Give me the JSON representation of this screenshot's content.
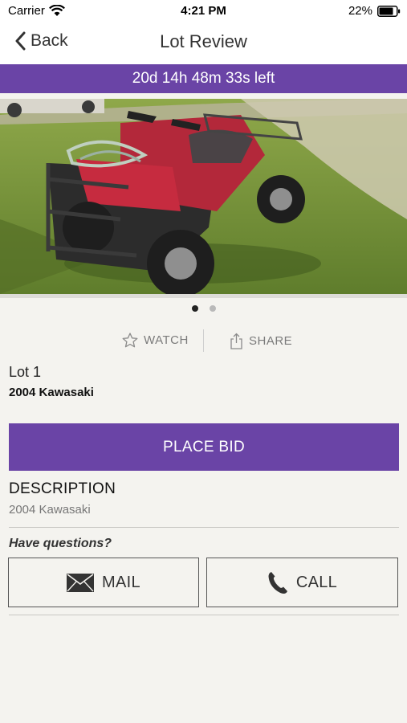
{
  "status": {
    "carrier": "Carrier",
    "time": "4:21 PM",
    "battery": "22%"
  },
  "nav": {
    "back_label": "Back",
    "title": "Lot Review"
  },
  "timer": {
    "text": "20d 14h 48m 33s left"
  },
  "gallery": {
    "page_count": 2,
    "current_page": 1
  },
  "actions": {
    "watch_label": "WATCH",
    "share_label": "SHARE"
  },
  "lot": {
    "label": "Lot 1",
    "title": "2004 Kawasaki"
  },
  "bid": {
    "label": "PLACE BID"
  },
  "description": {
    "heading": "DESCRIPTION",
    "text": "2004 Kawasaki"
  },
  "contact": {
    "prompt": "Have questions?",
    "mail_label": "MAIL",
    "call_label": "CALL"
  },
  "colors": {
    "accent": "#6a44a6",
    "background": "#f4f3ef"
  }
}
